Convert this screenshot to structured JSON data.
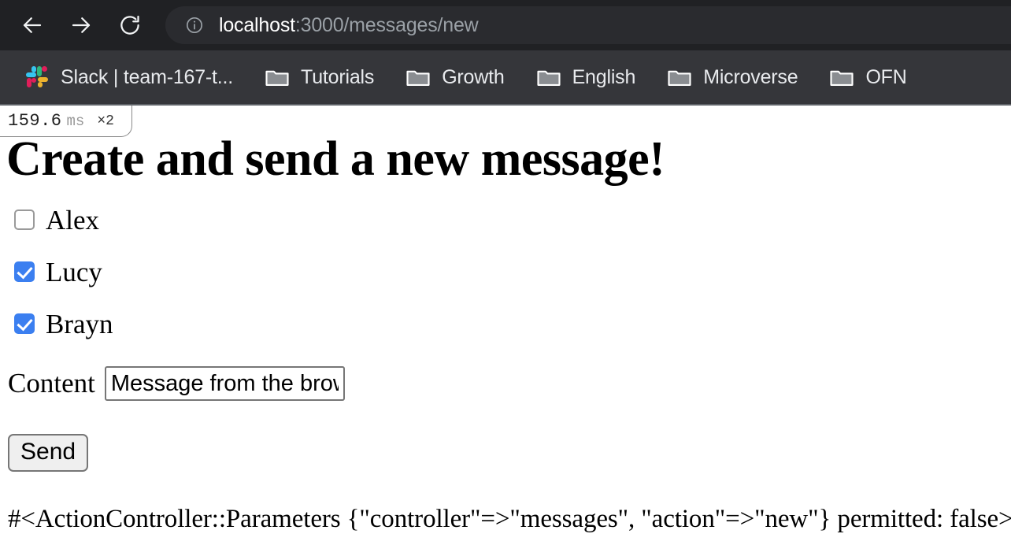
{
  "browser": {
    "nav": {
      "back_tooltip": "Back",
      "forward_tooltip": "Forward",
      "reload_tooltip": "Reload"
    },
    "omnibox": {
      "site_info_icon": "info-circle-icon",
      "host": "localhost",
      "path": ":3000/messages/new",
      "full_url": "localhost:3000/messages/new"
    },
    "bookmarks": [
      {
        "label": "Slack | team-167-t...",
        "icon": "slack-icon"
      },
      {
        "label": "Tutorials",
        "icon": "folder-icon"
      },
      {
        "label": "Growth",
        "icon": "folder-icon"
      },
      {
        "label": "English",
        "icon": "folder-icon"
      },
      {
        "label": "Microverse",
        "icon": "folder-icon"
      },
      {
        "label": "OFN",
        "icon": "folder-icon"
      }
    ],
    "colors": {
      "toolbar_bg": "#202124",
      "omnibox_bg": "#2a2b2f",
      "bookmarks_bg": "#35363a",
      "text": "#e8eaed",
      "muted_text": "#9aa0a6"
    }
  },
  "profiler": {
    "time": "159.6",
    "unit": "ms",
    "count": "×2"
  },
  "page": {
    "title": "Create and send a new message!",
    "recipients": [
      {
        "name": "Alex",
        "checked": false
      },
      {
        "name": "Lucy",
        "checked": true
      },
      {
        "name": "Brayn",
        "checked": true
      }
    ],
    "content_field": {
      "label": "Content",
      "value": "Message from the brows",
      "placeholder": ""
    },
    "submit_label": "Send",
    "params_output": "#<ActionController::Parameters {\"controller\"=>\"messages\", \"action\"=>\"new\"} permitted: false>",
    "colors": {
      "checkbox_checked": "#3b7ff0",
      "checkbox_border": "#9a9a9a",
      "button_bg": "#efefef",
      "field_border": "#767676"
    }
  }
}
